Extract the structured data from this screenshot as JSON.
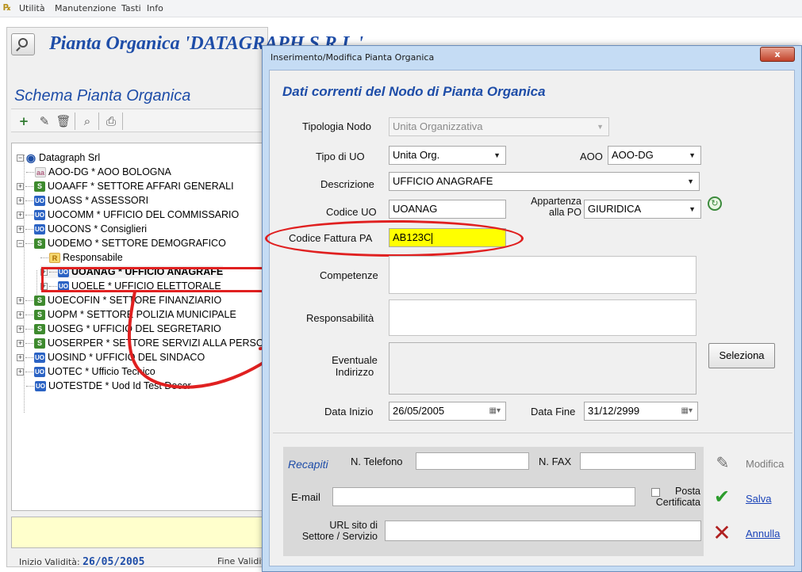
{
  "menu": [
    "Utilità",
    "Manutenzione",
    "Tasti",
    "Info"
  ],
  "main": {
    "app_title": "Pianta Organica 'DATAGRAPH S.R.L.'",
    "schema_title": "Schema Pianta Organica",
    "tree": {
      "root": "Datagraph Srl",
      "nodes": [
        {
          "icon": "aoo",
          "label": "AOO-DG * AOO BOLOGNA"
        },
        {
          "icon": "s",
          "label": "UOAAFF * SETTORE AFFARI GENERALI"
        },
        {
          "icon": "uo",
          "label": "UOASS * ASSESSORI"
        },
        {
          "icon": "uo",
          "label": "UOCOMM * UFFICIO DEL COMMISSARIO"
        },
        {
          "icon": "uo",
          "label": "UOCONS * Consiglieri"
        },
        {
          "icon": "s",
          "label": "UODEMO * SETTORE DEMOGRAFICO"
        },
        {
          "icon": "r",
          "label": "Responsabile"
        },
        {
          "icon": "uo",
          "label": "UOANAG * UFFICIO ANAGRAFE"
        },
        {
          "icon": "uo",
          "label": "UOELE * UFFICIO ELETTORALE"
        },
        {
          "icon": "s",
          "label": "UOECOFIN * SETTORE FINANZIARIO"
        },
        {
          "icon": "s",
          "label": "UOPM * SETTORE POLIZIA MUNICIPALE"
        },
        {
          "icon": "s",
          "label": "UOSEG * UFFICIO DEL SEGRETARIO"
        },
        {
          "icon": "s",
          "label": "UOSERPER * SETTORE SERVIZI ALLA PERSONA"
        },
        {
          "icon": "uo",
          "label": "UOSIND * UFFICIO DEL SINDACO"
        },
        {
          "icon": "uo",
          "label": "UOTEC * Ufficio Tecnico"
        },
        {
          "icon": "uo",
          "label": "UOTESTDE * Uod Id Test Docer"
        }
      ]
    },
    "status": {
      "inizio_label": "Inizio Validità:",
      "inizio_value": "26/05/2005",
      "fine_label": "Fine Validità:"
    }
  },
  "dialog": {
    "title": "Inserimento/Modifica Pianta Organica",
    "close": "x",
    "heading": "Dati correnti del Nodo di Pianta Organica",
    "tipologia_label": "Tipologia Nodo",
    "tipologia_value": "Unita Organizzativa",
    "tipo_uo_label": "Tipo di UO",
    "tipo_uo_value": "Unita Org.",
    "aoo_label": "AOO",
    "aoo_value": "AOO-DG",
    "descrizione_label": "Descrizione",
    "descrizione_value": "UFFICIO ANAGRAFE",
    "codice_uo_label": "Codice UO",
    "codice_uo_value": "UOANAG",
    "appartenenza_label_1": "Appartenza",
    "appartenenza_label_2": "alla PO",
    "appartenenza_value": "GIURIDICA",
    "codice_fattura_label": "Codice Fattura PA",
    "codice_fattura_value": "AB123C",
    "competenze_label": "Competenze",
    "responsabilita_label": "Responsabilità",
    "indirizzo_label_1": "Eventuale",
    "indirizzo_label_2": "Indirizzo",
    "seleziona": "Seleziona",
    "data_inizio_label": "Data Inizio",
    "data_inizio_value": "26/05/2005",
    "data_fine_label": "Data Fine",
    "data_fine_value": "31/12/2999",
    "recapiti": "Recapiti",
    "telefono_label": "N. Telefono",
    "fax_label": "N. FAX",
    "email_label": "E-mail",
    "posta_label_1": "Posta",
    "posta_label_2": "Certificata",
    "url_label_1": "URL sito di",
    "url_label_2": "Settore / Servizio",
    "modifica": "Modifica",
    "salva": "Salva",
    "annulla": "Annulla"
  }
}
